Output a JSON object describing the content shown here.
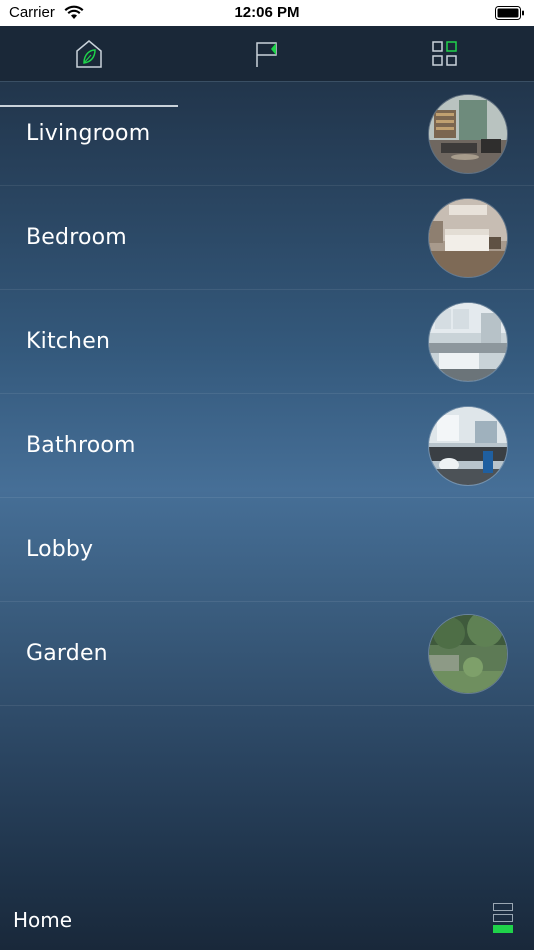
{
  "status_bar": {
    "carrier": "Carrier",
    "time": "12:06 PM"
  },
  "tabs": [
    {
      "icon": "home-leaf-icon",
      "active": true
    },
    {
      "icon": "flag-icon",
      "active": false
    },
    {
      "icon": "grid-icon",
      "active": false
    }
  ],
  "rooms": [
    {
      "label": "Livingroom",
      "has_image": true
    },
    {
      "label": "Bedroom",
      "has_image": true
    },
    {
      "label": "Kitchen",
      "has_image": true
    },
    {
      "label": "Bathroom",
      "has_image": true
    },
    {
      "label": "Lobby",
      "has_image": false
    },
    {
      "label": "Garden",
      "has_image": true
    }
  ],
  "footer": {
    "label": "Home",
    "level_icon": "level-indicator-icon",
    "level_filled": 1,
    "level_total": 3
  },
  "colors": {
    "accent_green": "#1fd34a",
    "tab_bar": "#1a2838"
  }
}
